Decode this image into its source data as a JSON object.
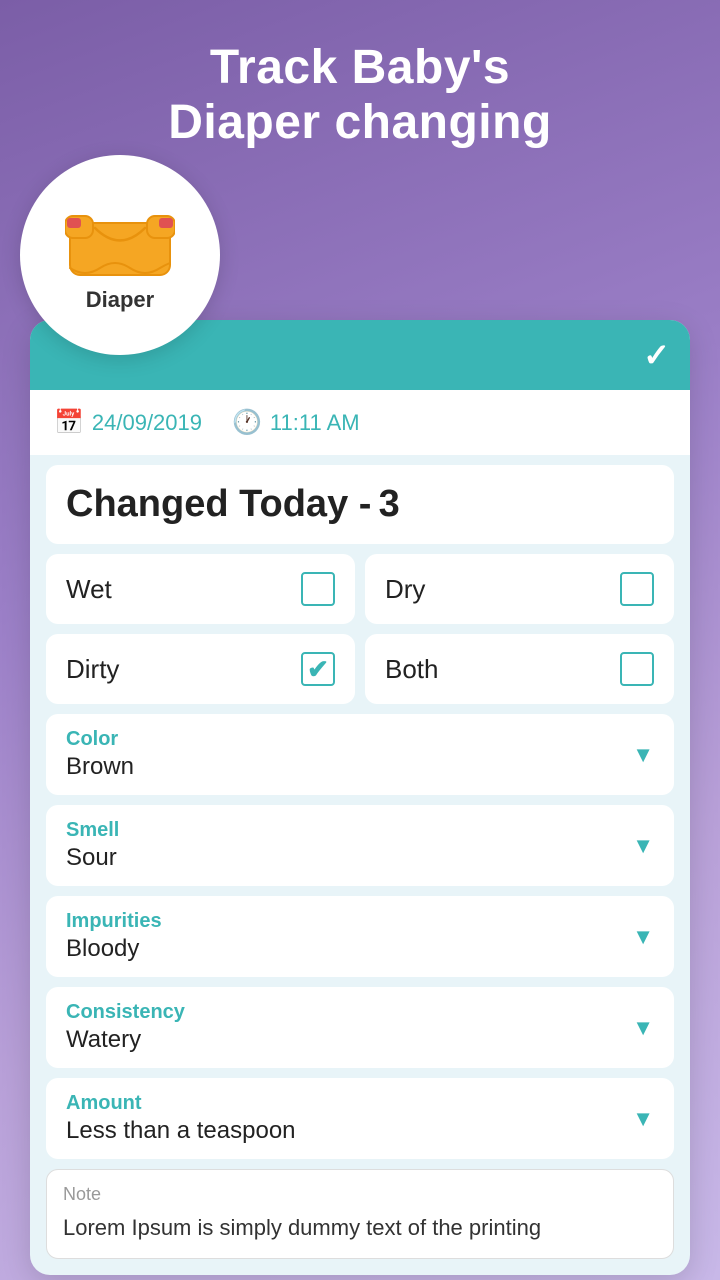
{
  "header": {
    "title_line1": "Track Baby's",
    "title_line2": "Diaper changing"
  },
  "diaper_icon": {
    "label": "Diaper"
  },
  "card": {
    "confirm_icon": "✓",
    "date": "24/09/2019",
    "time": "11:11 AM",
    "changed_today_label": "Changed Today -",
    "changed_today_count": "3",
    "checkboxes": [
      {
        "label": "Wet",
        "checked": false
      },
      {
        "label": "Dry",
        "checked": false
      },
      {
        "label": "Dirty",
        "checked": true
      },
      {
        "label": "Both",
        "checked": false
      }
    ],
    "dropdowns": [
      {
        "field": "Color",
        "value": "Brown"
      },
      {
        "field": "Smell",
        "value": "Sour"
      },
      {
        "field": "Impurities",
        "value": "Bloody"
      },
      {
        "field": "Consistency",
        "value": "Watery"
      },
      {
        "field": "Amount",
        "value": "Less than a teaspoon"
      }
    ],
    "note": {
      "placeholder": "Note",
      "text": "Lorem Ipsum is simply dummy text of the printing"
    }
  }
}
